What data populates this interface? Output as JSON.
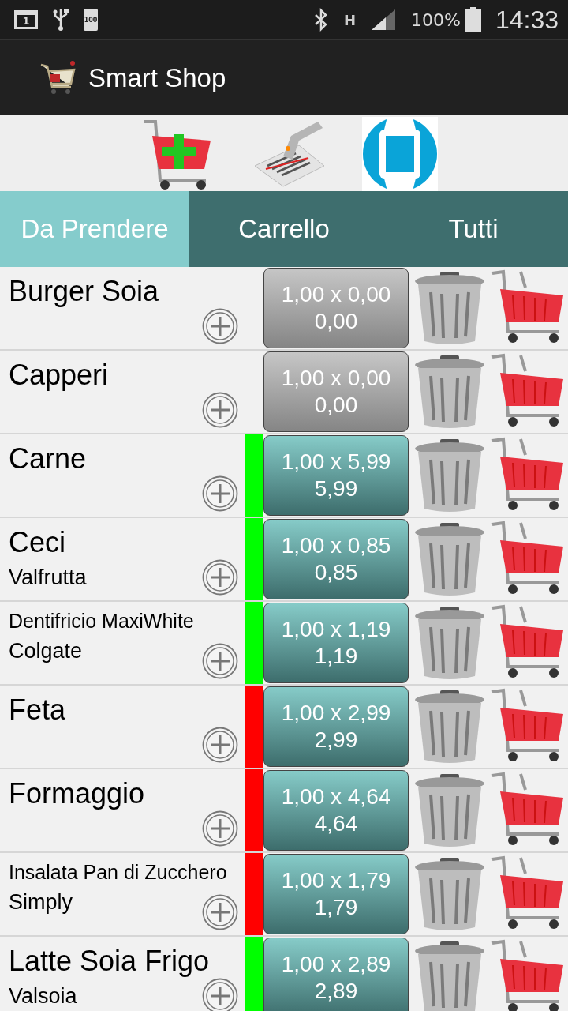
{
  "status_bar": {
    "calendar_day": "1",
    "battery_mini": "100",
    "network_type": "H",
    "battery": "100%",
    "time": "14:33"
  },
  "app_bar": {
    "title": "Smart Shop"
  },
  "tabs": [
    {
      "label": "Da Prendere",
      "selected": true
    },
    {
      "label": "Carrello",
      "selected": false
    },
    {
      "label": "Tutti",
      "selected": false
    }
  ],
  "items": [
    {
      "name": "Burger Soia",
      "price": "1,00 x 0,00",
      "total": "0,00",
      "kind": "unpriced"
    },
    {
      "name": "Capperi",
      "price": "1,00 x 0,00",
      "total": "0,00",
      "kind": "unpriced"
    },
    {
      "name": "Carne",
      "price": "1,00 x 5,99",
      "total": "5,99",
      "kind": "priced",
      "color": "#00ff00"
    },
    {
      "name": "Ceci",
      "brand": "Valfrutta",
      "price": "1,00 x 0,85",
      "total": "0,85",
      "kind": "priced",
      "color": "#00ff00"
    },
    {
      "name": "Dentifricio MaxiWhite",
      "brand": "Colgate",
      "price": "1,00 x 1,19",
      "total": "1,19",
      "kind": "priced",
      "color": "#00ff00"
    },
    {
      "name": "Feta",
      "price": "1,00 x 2,99",
      "total": "2,99",
      "kind": "priced",
      "color": "#ff0000"
    },
    {
      "name": "Formaggio",
      "price": "1,00 x 4,64",
      "total": "4,64",
      "kind": "priced",
      "color": "#ff0000"
    },
    {
      "name": "Insalata Pan di Zucchero",
      "brand": "Simply",
      "price": "1,00 x 1,79",
      "total": "1,79",
      "kind": "priced",
      "color": "#ff0000"
    },
    {
      "name": "Latte Soia Frigo",
      "brand": "Valsoia",
      "price": "1,00 x 2,89",
      "total": "2,89",
      "kind": "priced",
      "color": "#00ff00"
    }
  ]
}
